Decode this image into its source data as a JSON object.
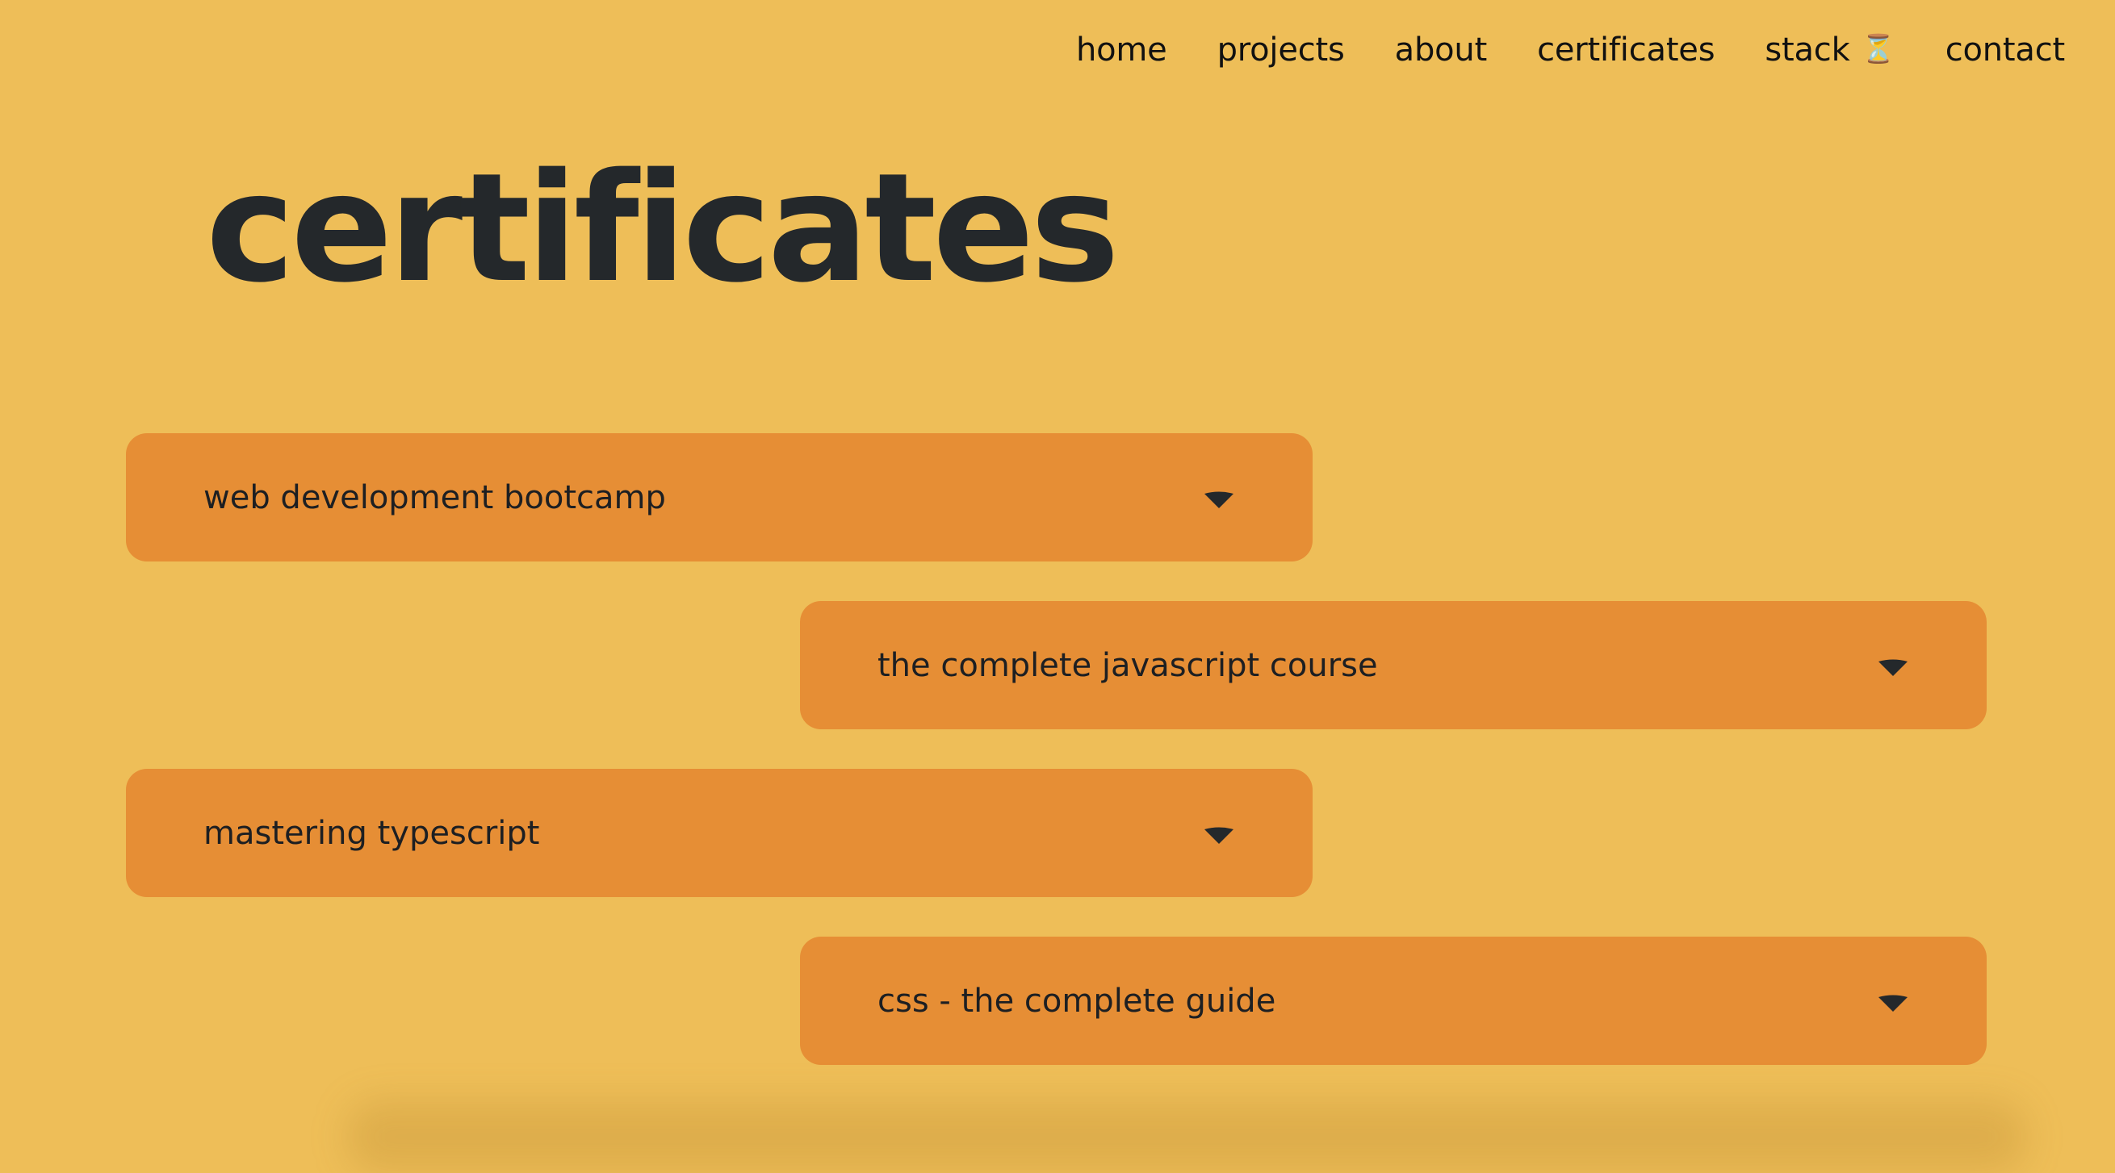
{
  "theme": {
    "background": "#EEBE58",
    "card": "#E68E35",
    "text": "#1f2326"
  },
  "nav": {
    "items": [
      {
        "label": "home"
      },
      {
        "label": "projects"
      },
      {
        "label": "about"
      },
      {
        "label": "certificates"
      },
      {
        "label": "stack",
        "suffix": "⏳",
        "icon": "hourglass-icon"
      },
      {
        "label": "contact"
      }
    ]
  },
  "page": {
    "title": "certificates"
  },
  "certificates": [
    {
      "title": "web development bootcamp",
      "icon": "chevron-down-icon"
    },
    {
      "title": "the complete javascript course",
      "icon": "chevron-down-icon"
    },
    {
      "title": "mastering typescript",
      "icon": "chevron-down-icon"
    },
    {
      "title": "css - the complete guide",
      "icon": "chevron-down-icon"
    }
  ]
}
